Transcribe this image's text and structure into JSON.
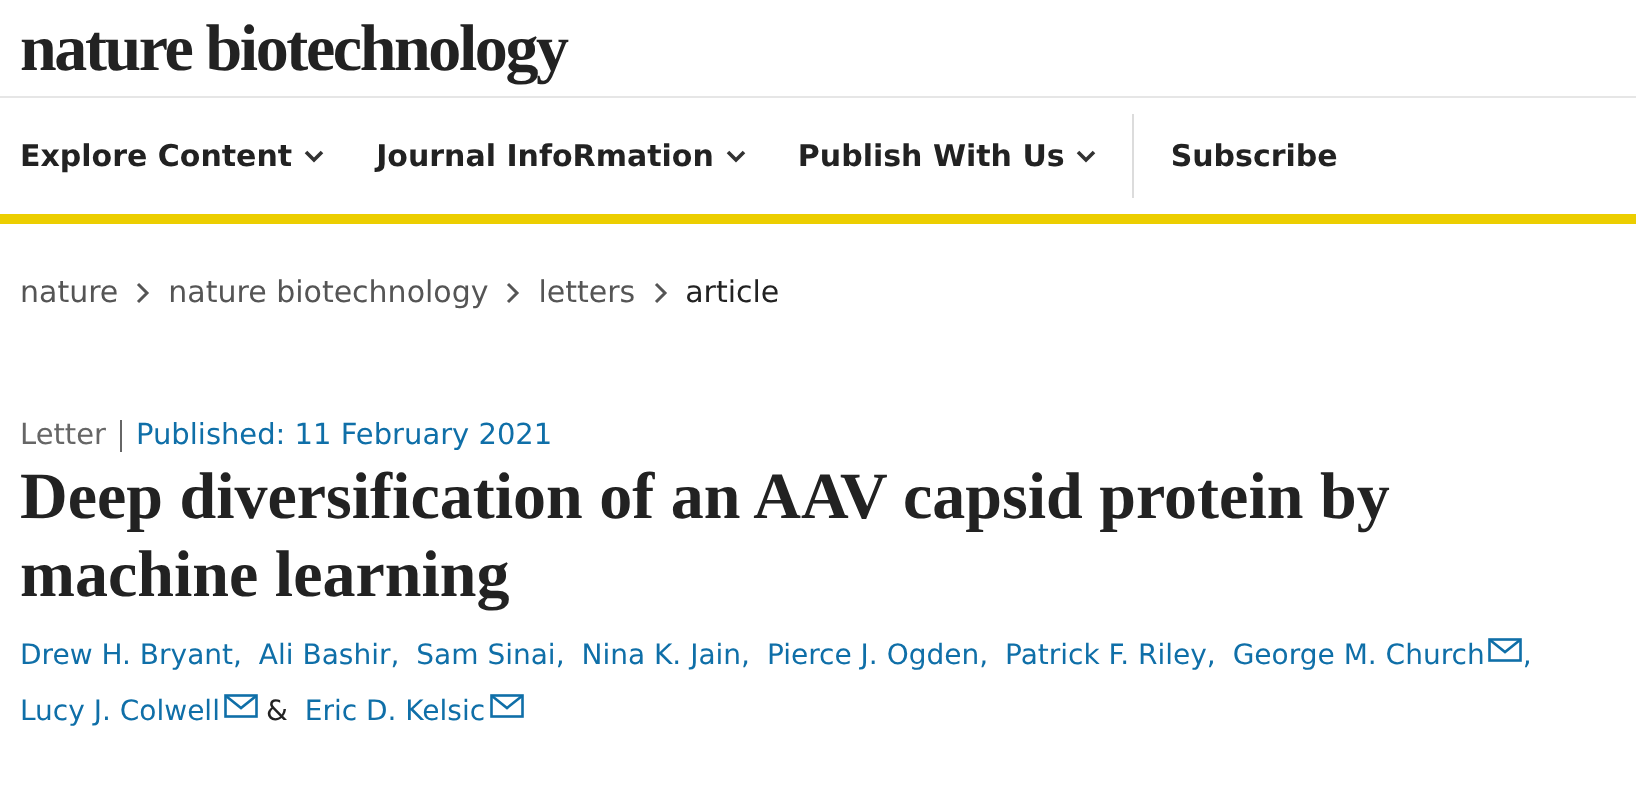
{
  "logo": "nature biotechnology",
  "nav": [
    {
      "label": "Explore Content",
      "dropdown": true
    },
    {
      "label": "Journal InfoRmation",
      "dropdown": true
    },
    {
      "label": "Publish With Us",
      "dropdown": true
    },
    {
      "label": "Subscribe",
      "dropdown": false
    }
  ],
  "breadcrumb": [
    {
      "label": "nature",
      "current": false
    },
    {
      "label": "nature biotechnology",
      "current": false
    },
    {
      "label": "letters",
      "current": false
    },
    {
      "label": "article",
      "current": true
    }
  ],
  "article_type": "Letter",
  "published": "Published: 11 February 2021",
  "title": "Deep diversification of an AAV capsid protein by machine learning",
  "authors": [
    {
      "name": "Drew H. Bryant",
      "email": false,
      "separator": ","
    },
    {
      "name": "Ali Bashir",
      "email": false,
      "separator": ","
    },
    {
      "name": "Sam Sinai",
      "email": false,
      "separator": ","
    },
    {
      "name": "Nina K. Jain",
      "email": false,
      "separator": ","
    },
    {
      "name": "Pierce J. Ogden",
      "email": false,
      "separator": ","
    },
    {
      "name": "Patrick F. Riley",
      "email": false,
      "separator": ","
    },
    {
      "name": "George M. Church",
      "email": true,
      "separator": ","
    },
    {
      "name": "Lucy J. Colwell",
      "email": true,
      "separator": "&"
    },
    {
      "name": "Eric D. Kelsic",
      "email": true
    }
  ]
}
